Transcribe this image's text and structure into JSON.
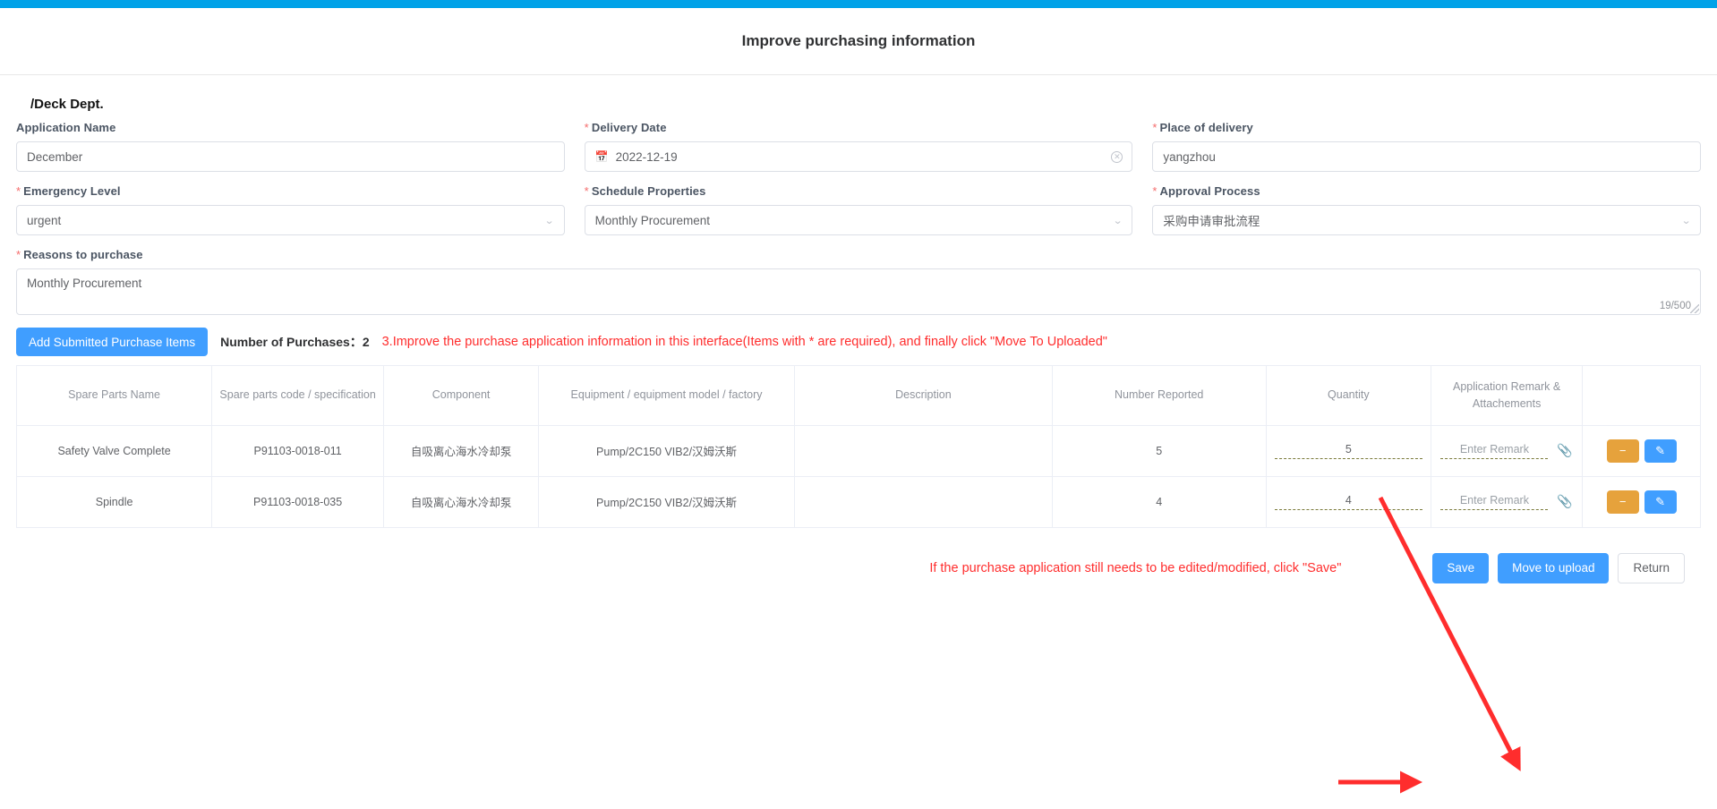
{
  "header": {
    "title": "Improve purchasing information"
  },
  "breadcrumb": {
    "text": "/Deck Dept."
  },
  "form": {
    "application_name": {
      "label": "Application Name",
      "required": false,
      "value": "December"
    },
    "delivery_date": {
      "label": "Delivery Date",
      "required": true,
      "value": "2022-12-19",
      "icon": "calendar-icon",
      "clear_icon": "clear-circle-icon"
    },
    "place_of_delivery": {
      "label": "Place of delivery",
      "required": true,
      "value": "yangzhou"
    },
    "emergency_level": {
      "label": "Emergency Level",
      "required": true,
      "value": "urgent"
    },
    "schedule_properties": {
      "label": "Schedule Properties",
      "required": true,
      "value": "Monthly Procurement"
    },
    "approval_process": {
      "label": "Approval Process",
      "required": true,
      "value": "采购申请审批流程"
    },
    "reasons_to_purchase": {
      "label": "Reasons to purchase",
      "required": true,
      "value": "Monthly Procurement",
      "counter": "19/500"
    }
  },
  "toolbar": {
    "add_button": "Add Submitted Purchase Items",
    "count_label": "Number of Purchases：",
    "count_value": "2",
    "annotation": "3.Improve the purchase application information in this interface(Items with * are required), and finally click \"Move To Uploaded\""
  },
  "table": {
    "columns": [
      "Spare Parts Name",
      "Spare parts code / specification",
      "Component",
      "Equipment / equipment model / factory",
      "Description",
      "Number Reported",
      "Quantity",
      "Application Remark & Attachements",
      ""
    ],
    "rows": [
      {
        "spare_parts_name": "Safety Valve Complete",
        "spare_parts_code": "P91103-0018-011",
        "component": "自吸离心海水冷却泵",
        "equipment": "Pump/2C150 VIB2/汉姆沃斯",
        "description": "",
        "number_reported": "5",
        "quantity": "5",
        "remark_placeholder": "Enter Remark",
        "attach_icon": "paperclip-icon",
        "remove_icon": "minus-icon",
        "edit_icon": "pencil-icon"
      },
      {
        "spare_parts_name": "Spindle",
        "spare_parts_code": "P91103-0018-035",
        "component": "自吸离心海水冷却泵",
        "equipment": "Pump/2C150 VIB2/汉姆沃斯",
        "description": "",
        "number_reported": "4",
        "quantity": "4",
        "remark_placeholder": "Enter Remark",
        "attach_icon": "paperclip-icon",
        "remove_icon": "minus-icon",
        "edit_icon": "pencil-icon"
      }
    ]
  },
  "footer": {
    "note": "If the purchase application still needs to be edited/modified, click \"Save\"",
    "save": "Save",
    "move_to_upload": "Move to upload",
    "return": "Return"
  },
  "colors": {
    "top_bar": "#00a2e8",
    "primary": "#409eff",
    "warning": "#e6a23c",
    "annotation_red": "#ff2d2d",
    "required_star": "#f56c6c"
  }
}
